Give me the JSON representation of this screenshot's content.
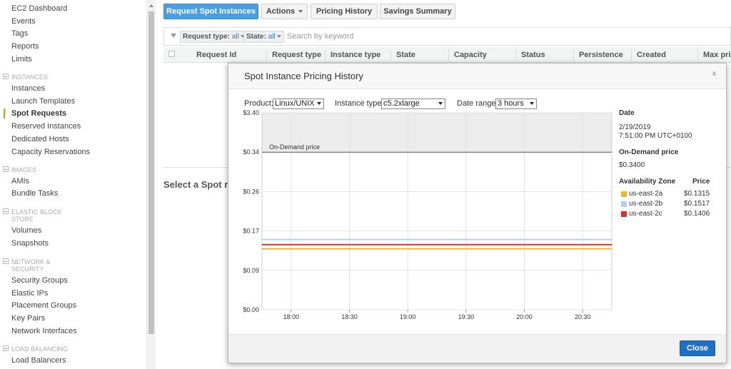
{
  "sidebar": {
    "top_items": [
      "EC2 Dashboard",
      "Events",
      "Tags",
      "Reports",
      "Limits"
    ],
    "sections": [
      {
        "title_lines": [
          "INSTANCES"
        ],
        "items": [
          "Instances",
          "Launch Templates",
          "Spot Requests",
          "Reserved Instances",
          "Dedicated Hosts",
          "Capacity Reservations"
        ]
      },
      {
        "title_lines": [
          "IMAGES"
        ],
        "items": [
          "AMIs",
          "Bundle Tasks"
        ]
      },
      {
        "title_lines": [
          "ELASTIC BLOCK",
          "STORE"
        ],
        "items": [
          "Volumes",
          "Snapshots"
        ]
      },
      {
        "title_lines": [
          "NETWORK &",
          "SECURITY"
        ],
        "items": [
          "Security Groups",
          "Elastic IPs",
          "Placement Groups",
          "Key Pairs",
          "Network Interfaces"
        ]
      },
      {
        "title_lines": [
          "LOAD BALANCING"
        ],
        "items": [
          "Load Balancers"
        ]
      }
    ],
    "active_item": "Spot Requests",
    "active_color": "#e88f00"
  },
  "toolbar": {
    "request_spot": "Request Spot Instances",
    "actions": "Actions",
    "pricing_history": "Pricing History",
    "savings_summary": "Savings Summary"
  },
  "filter": {
    "request_type_label": "Request type:",
    "request_type_value": "all",
    "state_label": "State:",
    "state_value": "all",
    "search_placeholder": "Search by keyword"
  },
  "table": {
    "columns": [
      "Request Id",
      "Request type",
      "Instance type",
      "State",
      "Capacity",
      "Status",
      "Persistence",
      "Created",
      "Max pric"
    ]
  },
  "lower_panel": {
    "text": "Select a Spot r"
  },
  "modal": {
    "title": "Spot Instance Pricing History",
    "close_x": "x",
    "product_label": "Product:",
    "product_value": "Linux/UNIX",
    "instance_type_label": "Instance type:",
    "instance_type_value": "c5.2xlarge",
    "date_range_label": "Date range:",
    "date_range_value": "3 hours",
    "close_button": "Close"
  },
  "chart_data": {
    "type": "line",
    "x_ticks": [
      "18:00",
      "18:30",
      "19:00",
      "19:30",
      "20:00",
      "20:30"
    ],
    "y_ticks": [
      {
        "label": "$0.00",
        "value": 0.0
      },
      {
        "label": "$0.09",
        "value": 0.085
      },
      {
        "label": "$0.17",
        "value": 0.17
      },
      {
        "label": "$0.26",
        "value": 0.255
      },
      {
        "label": "$0.34",
        "value": 0.34
      },
      {
        "label": "$3.40",
        "value": 0.425
      }
    ],
    "ylim": [
      0,
      0.425
    ],
    "on_demand": {
      "label": "On-Demand price",
      "value": 0.34
    },
    "series": [
      {
        "name": "us-east-2a",
        "color": "#f0b429",
        "value": 0.1315
      },
      {
        "name": "us-east-2b",
        "color": "#b8d0ee",
        "value": 0.1517
      },
      {
        "name": "us-east-2c",
        "color": "#d9302c",
        "value": 0.1406
      }
    ]
  },
  "info_panel": {
    "date_heading": "Date",
    "date_value": "2/19/2019",
    "time_value": "7:51:00 PM UTC+0100",
    "on_demand_heading": "On-Demand price",
    "on_demand_value": "$0.3400",
    "az_heading": "Availability Zone",
    "price_heading": "Price",
    "rows": [
      {
        "zone": "us-east-2a",
        "price": "$0.1315",
        "color": "#f0b429"
      },
      {
        "zone": "us-east-2b",
        "price": "$0.1517",
        "color": "#b8d0ee"
      },
      {
        "zone": "us-east-2c",
        "price": "$0.1406",
        "color": "#d9302c"
      }
    ]
  }
}
